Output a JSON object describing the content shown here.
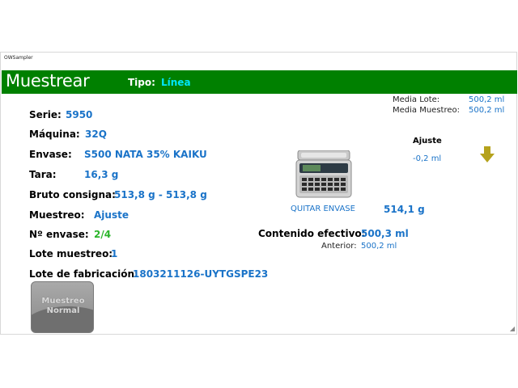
{
  "window": {
    "title": "OWSampler"
  },
  "header": {
    "title": "Muestrear",
    "tipo_label": "Tipo:",
    "tipo_value": "Línea"
  },
  "fields": {
    "serie": {
      "label": "Serie:",
      "value": "5950"
    },
    "maquina": {
      "label": "Máquina:",
      "value": "32Q"
    },
    "envase": {
      "label": "Envase:",
      "value": "S500 NATA 35% KAIKU"
    },
    "tara": {
      "label": "Tara:",
      "value": "16,3 g"
    },
    "bruto": {
      "label": "Bruto consigna:",
      "value": "513,8 g - 513,8 g"
    },
    "muestreo": {
      "label": "Muestreo:",
      "value": "Ajuste"
    },
    "n_envase": {
      "label": "Nº envase:",
      "value": "2/4"
    },
    "lote_muestreo": {
      "label": "Lote muestreo:",
      "value": "1"
    },
    "lote_fabricacion": {
      "label": "Lote de fabricación:",
      "value": "1803211126-UYTGSPE23"
    }
  },
  "stats": {
    "media_lote_label": "Media Lote:",
    "media_lote_value": "500,2 ml",
    "media_muestreo_label": "Media Muestreo:",
    "media_muestreo_value": "500,2 ml"
  },
  "ajuste": {
    "title": "Ajuste",
    "value": "-0,2 ml",
    "arrow_icon": "arrow-down-icon",
    "arrow_color": "#b5a21c"
  },
  "scale": {
    "icon": "weighing-scale-icon",
    "button_label": "QUITAR ENVASE",
    "weight": "514,1 g"
  },
  "contenido": {
    "label": "Contenido efectivo:",
    "value": "500,3 ml",
    "anterior_label": "Anterior:",
    "anterior_value": "500,2 ml"
  },
  "mode_button": {
    "label_line1": "Muestreo",
    "label_line2": "Normal"
  },
  "colors": {
    "header_bg": "#008000",
    "accent_blue": "#1a73c8",
    "tipo_cyan": "#00e5ff",
    "green_value": "#2bb52b"
  }
}
